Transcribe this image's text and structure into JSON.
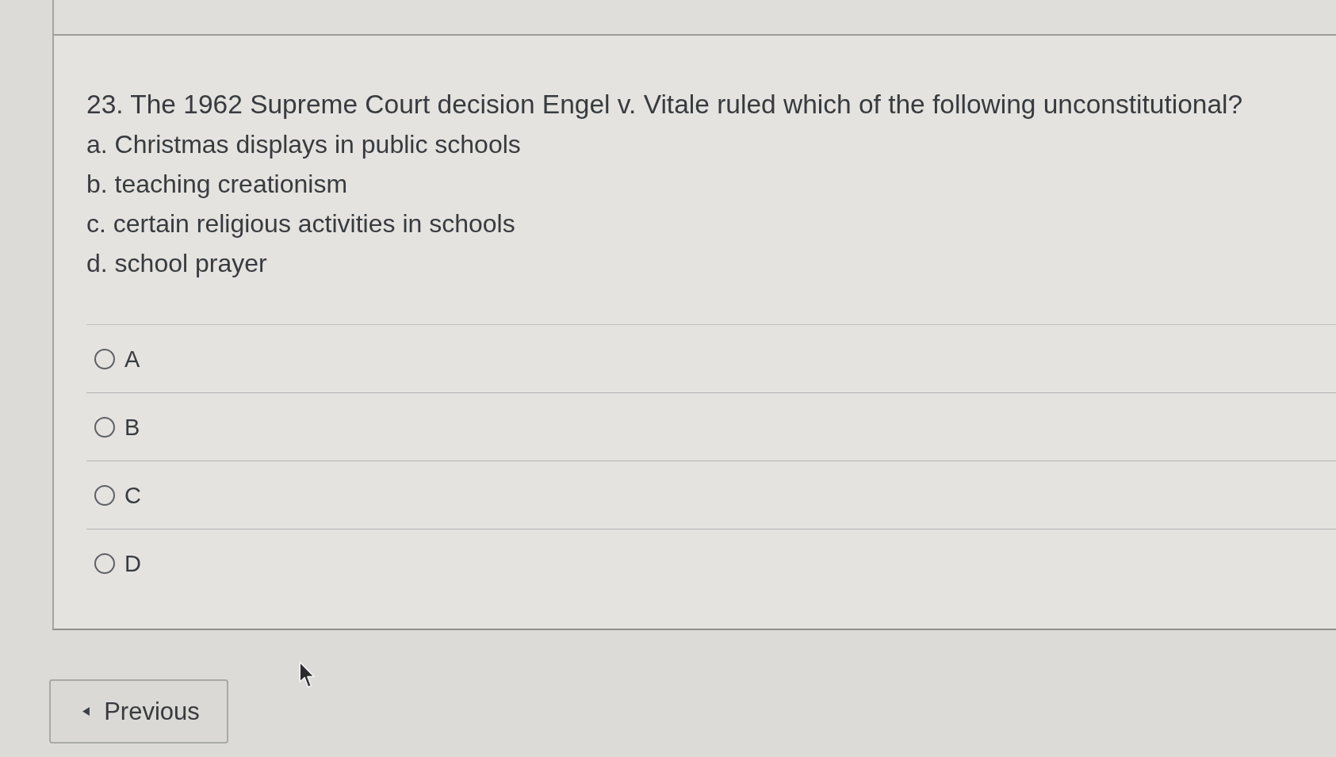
{
  "question": {
    "text": "23. The 1962 Supreme Court decision Engel v. Vitale ruled which of the following unconstitutional?",
    "choices": [
      "a. Christmas displays in public schools",
      "b. teaching creationism",
      "c. certain religious activities in schools",
      "d. school prayer"
    ]
  },
  "answers": [
    {
      "label": "A",
      "selected": false
    },
    {
      "label": "B",
      "selected": false
    },
    {
      "label": "C",
      "selected": false
    },
    {
      "label": "D",
      "selected": false
    }
  ],
  "navigation": {
    "previous_button": "Previous"
  }
}
